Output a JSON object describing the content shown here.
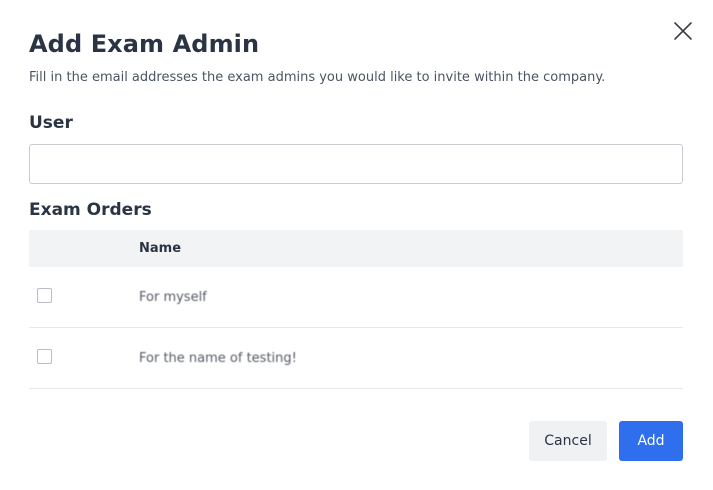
{
  "modal": {
    "title": "Add Exam Admin",
    "subtitle": "Fill in the email addresses the exam admins you would like to invite within the company.",
    "close_icon": "close-icon"
  },
  "user_field": {
    "label": "User",
    "value": "",
    "placeholder": ""
  },
  "exam_orders": {
    "label": "Exam Orders",
    "columns": [
      "",
      "Name"
    ],
    "rows": [
      {
        "checked": false,
        "name": "For myself"
      },
      {
        "checked": false,
        "name": "For the name of testing!"
      }
    ]
  },
  "actions": {
    "cancel_label": "Cancel",
    "add_label": "Add"
  },
  "colors": {
    "primary": "#2f6fed",
    "secondary_bg": "#f0f1f3",
    "header_bg": "#f2f3f5",
    "text": "#2b3445"
  }
}
